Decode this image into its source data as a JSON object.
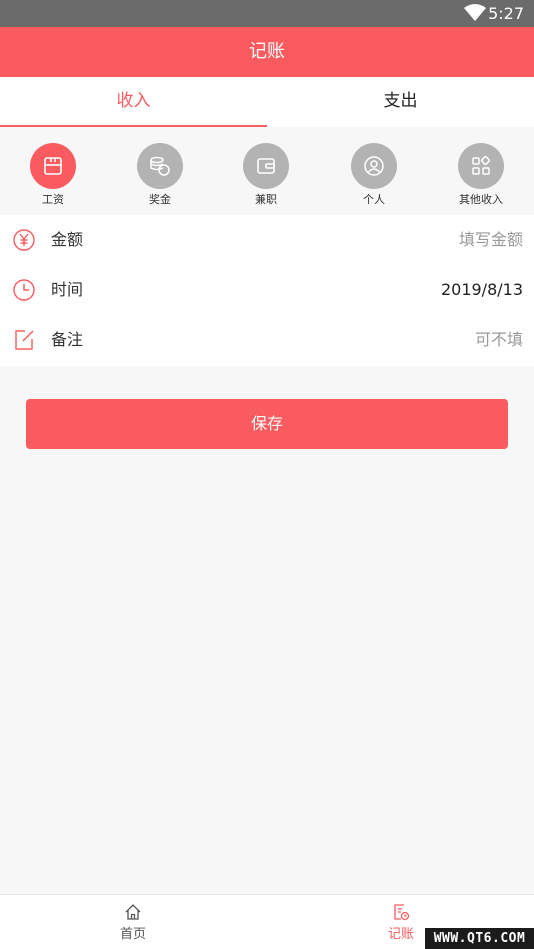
{
  "status_bar": {
    "time": "5:27"
  },
  "header": {
    "title": "记账"
  },
  "tabs": [
    {
      "label": "收入",
      "active": true
    },
    {
      "label": "支出",
      "active": false
    }
  ],
  "categories": [
    {
      "label": "工资",
      "icon": "wage-icon",
      "active": true
    },
    {
      "label": "奖金",
      "icon": "coins-icon",
      "active": false
    },
    {
      "label": "兼职",
      "icon": "wallet-icon",
      "active": false
    },
    {
      "label": "个人",
      "icon": "person-icon",
      "active": false
    },
    {
      "label": "其他收入",
      "icon": "grid-icon",
      "active": false
    }
  ],
  "form": {
    "amount": {
      "label": "金额",
      "placeholder": "填写金额",
      "icon": "yuan-icon"
    },
    "time": {
      "label": "时间",
      "value": "2019/8/13",
      "icon": "clock-icon"
    },
    "note": {
      "label": "备注",
      "placeholder": "可不填",
      "icon": "edit-icon"
    }
  },
  "save_label": "保存",
  "bottom_nav": [
    {
      "label": "首页",
      "icon": "home-icon",
      "active": false
    },
    {
      "label": "记账",
      "icon": "ledger-icon",
      "active": true
    }
  ],
  "watermark": "WWW.QT6.COM",
  "colors": {
    "accent": "#fa5b5f",
    "inactive_circle": "#b3b3b3",
    "status_bar": "#6b6b6b"
  }
}
